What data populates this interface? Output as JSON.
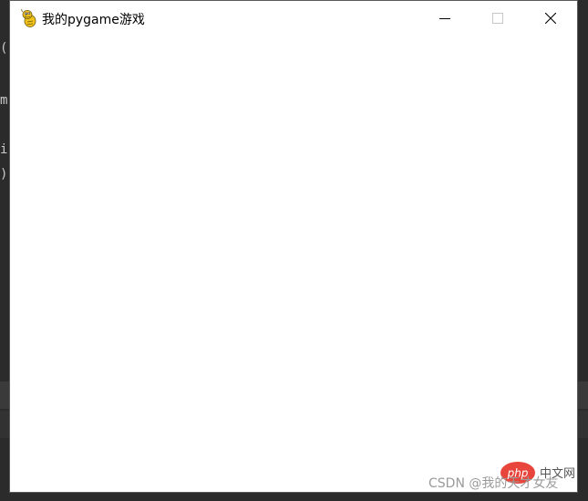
{
  "window": {
    "title": "我的pygame游戏",
    "icon": "pygame-snake-icon",
    "controls": {
      "minimize": "minimize-icon",
      "maximize": "maximize-icon",
      "close": "close-icon"
    }
  },
  "background_editor": {
    "fragments": [
      "(",
      "m",
      "i",
      ")"
    ]
  },
  "watermark": {
    "text": "CSDN @我的天才女友",
    "site_badge": "php",
    "site_label": "中文网"
  },
  "colors": {
    "window_bg": "#ffffff",
    "editor_bg": "#2b2b2b",
    "badge_red": "#e8453c"
  }
}
